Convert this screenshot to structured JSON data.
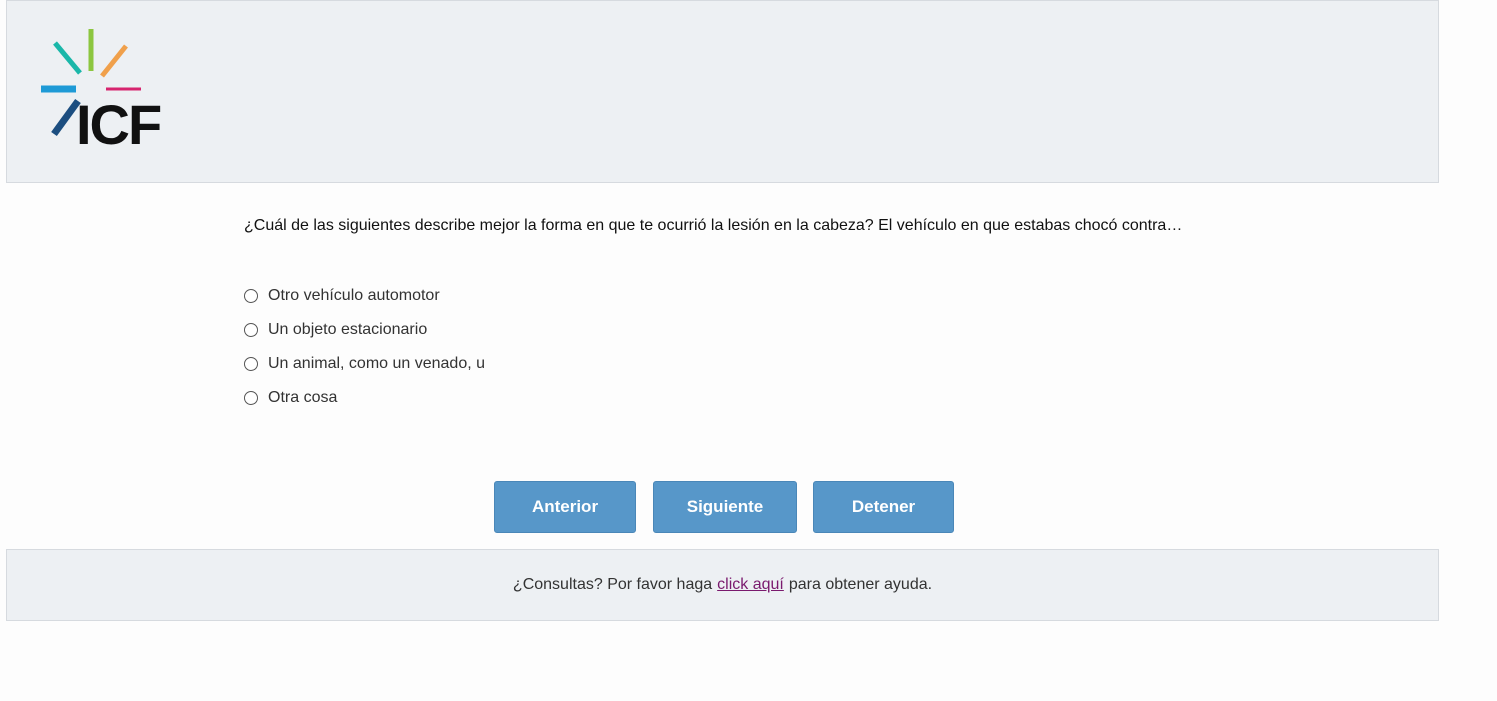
{
  "header": {
    "logo_text": "ICF",
    "brand_colors": [
      "#8cc63f",
      "#f0a04b",
      "#1ab7a9",
      "#1e9ad6",
      "#d6246e",
      "#1c4e80"
    ]
  },
  "question": {
    "text": "¿Cuál de las siguientes describe mejor la forma en que te ocurrió la lesión en la cabeza? El vehículo en que estabas chocó contra…"
  },
  "options": [
    {
      "label": "Otro vehículo automotor"
    },
    {
      "label": "Un objeto estacionario"
    },
    {
      "label": "Un animal, como un venado, u"
    },
    {
      "label": "Otra cosa"
    }
  ],
  "buttons": {
    "prev_label": "Anterior",
    "next_label": "Siguiente",
    "stop_label": "Detener",
    "color": "#5797c9"
  },
  "footer": {
    "text_before": "¿Consultas? Por favor haga",
    "link_text": "click aquí",
    "text_after": "para obtener ayuda."
  }
}
